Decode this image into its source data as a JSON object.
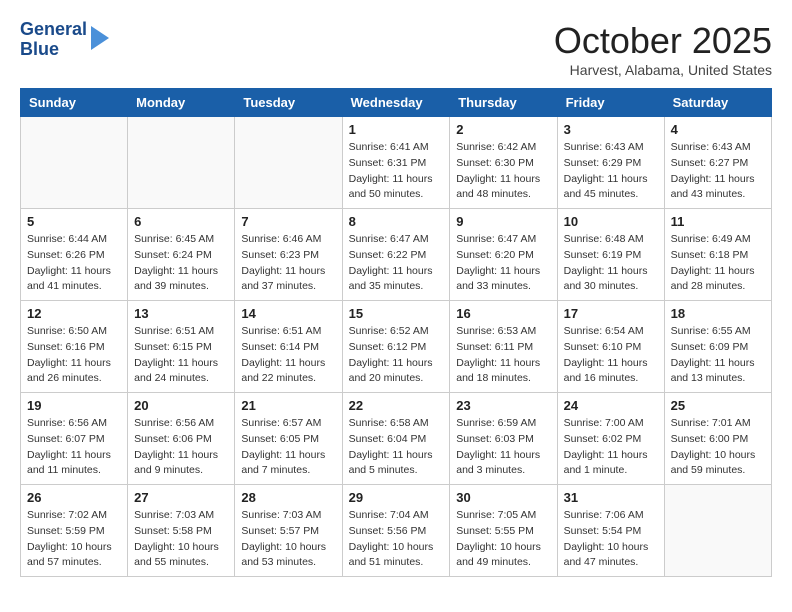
{
  "header": {
    "logo_line1": "General",
    "logo_line2": "Blue",
    "month": "October 2025",
    "location": "Harvest, Alabama, United States"
  },
  "days_of_week": [
    "Sunday",
    "Monday",
    "Tuesday",
    "Wednesday",
    "Thursday",
    "Friday",
    "Saturday"
  ],
  "weeks": [
    [
      {
        "day": "",
        "info": ""
      },
      {
        "day": "",
        "info": ""
      },
      {
        "day": "",
        "info": ""
      },
      {
        "day": "1",
        "info": "Sunrise: 6:41 AM\nSunset: 6:31 PM\nDaylight: 11 hours\nand 50 minutes."
      },
      {
        "day": "2",
        "info": "Sunrise: 6:42 AM\nSunset: 6:30 PM\nDaylight: 11 hours\nand 48 minutes."
      },
      {
        "day": "3",
        "info": "Sunrise: 6:43 AM\nSunset: 6:29 PM\nDaylight: 11 hours\nand 45 minutes."
      },
      {
        "day": "4",
        "info": "Sunrise: 6:43 AM\nSunset: 6:27 PM\nDaylight: 11 hours\nand 43 minutes."
      }
    ],
    [
      {
        "day": "5",
        "info": "Sunrise: 6:44 AM\nSunset: 6:26 PM\nDaylight: 11 hours\nand 41 minutes."
      },
      {
        "day": "6",
        "info": "Sunrise: 6:45 AM\nSunset: 6:24 PM\nDaylight: 11 hours\nand 39 minutes."
      },
      {
        "day": "7",
        "info": "Sunrise: 6:46 AM\nSunset: 6:23 PM\nDaylight: 11 hours\nand 37 minutes."
      },
      {
        "day": "8",
        "info": "Sunrise: 6:47 AM\nSunset: 6:22 PM\nDaylight: 11 hours\nand 35 minutes."
      },
      {
        "day": "9",
        "info": "Sunrise: 6:47 AM\nSunset: 6:20 PM\nDaylight: 11 hours\nand 33 minutes."
      },
      {
        "day": "10",
        "info": "Sunrise: 6:48 AM\nSunset: 6:19 PM\nDaylight: 11 hours\nand 30 minutes."
      },
      {
        "day": "11",
        "info": "Sunrise: 6:49 AM\nSunset: 6:18 PM\nDaylight: 11 hours\nand 28 minutes."
      }
    ],
    [
      {
        "day": "12",
        "info": "Sunrise: 6:50 AM\nSunset: 6:16 PM\nDaylight: 11 hours\nand 26 minutes."
      },
      {
        "day": "13",
        "info": "Sunrise: 6:51 AM\nSunset: 6:15 PM\nDaylight: 11 hours\nand 24 minutes."
      },
      {
        "day": "14",
        "info": "Sunrise: 6:51 AM\nSunset: 6:14 PM\nDaylight: 11 hours\nand 22 minutes."
      },
      {
        "day": "15",
        "info": "Sunrise: 6:52 AM\nSunset: 6:12 PM\nDaylight: 11 hours\nand 20 minutes."
      },
      {
        "day": "16",
        "info": "Sunrise: 6:53 AM\nSunset: 6:11 PM\nDaylight: 11 hours\nand 18 minutes."
      },
      {
        "day": "17",
        "info": "Sunrise: 6:54 AM\nSunset: 6:10 PM\nDaylight: 11 hours\nand 16 minutes."
      },
      {
        "day": "18",
        "info": "Sunrise: 6:55 AM\nSunset: 6:09 PM\nDaylight: 11 hours\nand 13 minutes."
      }
    ],
    [
      {
        "day": "19",
        "info": "Sunrise: 6:56 AM\nSunset: 6:07 PM\nDaylight: 11 hours\nand 11 minutes."
      },
      {
        "day": "20",
        "info": "Sunrise: 6:56 AM\nSunset: 6:06 PM\nDaylight: 11 hours\nand 9 minutes."
      },
      {
        "day": "21",
        "info": "Sunrise: 6:57 AM\nSunset: 6:05 PM\nDaylight: 11 hours\nand 7 minutes."
      },
      {
        "day": "22",
        "info": "Sunrise: 6:58 AM\nSunset: 6:04 PM\nDaylight: 11 hours\nand 5 minutes."
      },
      {
        "day": "23",
        "info": "Sunrise: 6:59 AM\nSunset: 6:03 PM\nDaylight: 11 hours\nand 3 minutes."
      },
      {
        "day": "24",
        "info": "Sunrise: 7:00 AM\nSunset: 6:02 PM\nDaylight: 11 hours\nand 1 minute."
      },
      {
        "day": "25",
        "info": "Sunrise: 7:01 AM\nSunset: 6:00 PM\nDaylight: 10 hours\nand 59 minutes."
      }
    ],
    [
      {
        "day": "26",
        "info": "Sunrise: 7:02 AM\nSunset: 5:59 PM\nDaylight: 10 hours\nand 57 minutes."
      },
      {
        "day": "27",
        "info": "Sunrise: 7:03 AM\nSunset: 5:58 PM\nDaylight: 10 hours\nand 55 minutes."
      },
      {
        "day": "28",
        "info": "Sunrise: 7:03 AM\nSunset: 5:57 PM\nDaylight: 10 hours\nand 53 minutes."
      },
      {
        "day": "29",
        "info": "Sunrise: 7:04 AM\nSunset: 5:56 PM\nDaylight: 10 hours\nand 51 minutes."
      },
      {
        "day": "30",
        "info": "Sunrise: 7:05 AM\nSunset: 5:55 PM\nDaylight: 10 hours\nand 49 minutes."
      },
      {
        "day": "31",
        "info": "Sunrise: 7:06 AM\nSunset: 5:54 PM\nDaylight: 10 hours\nand 47 minutes."
      },
      {
        "day": "",
        "info": ""
      }
    ]
  ]
}
